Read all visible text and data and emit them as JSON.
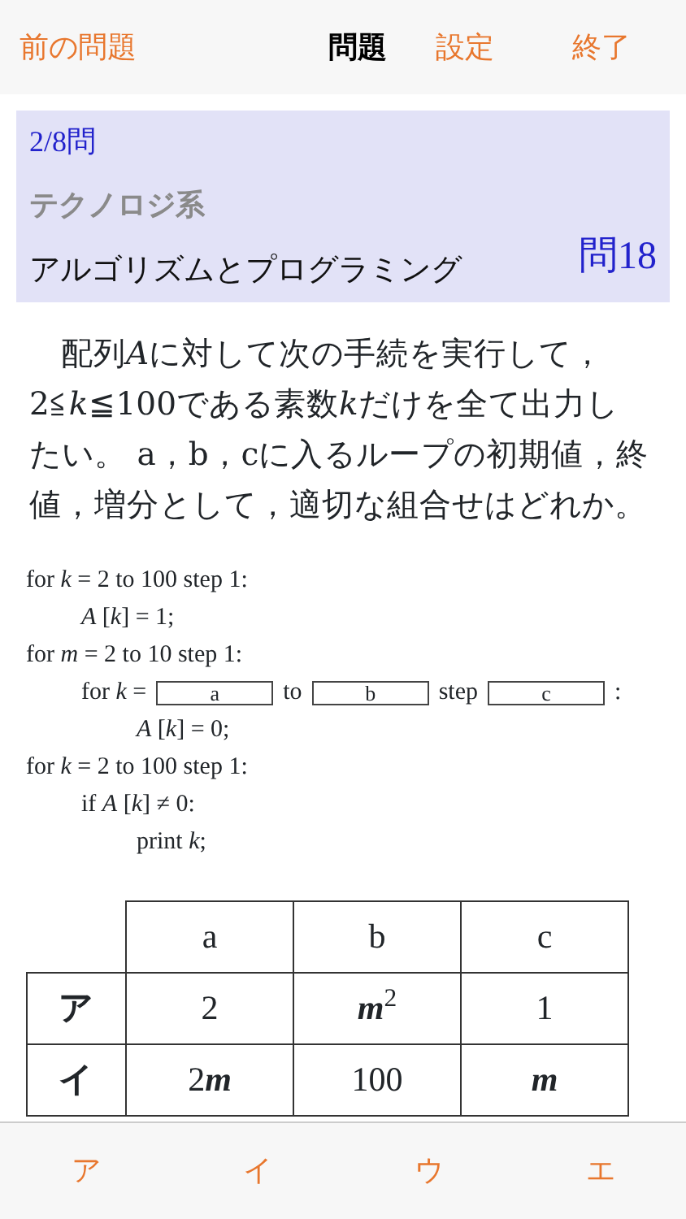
{
  "navbar": {
    "back": "前の問題",
    "title": "問題",
    "actions": [
      "設定",
      "終了"
    ]
  },
  "header": {
    "progress": "2/8問",
    "category": "テクノロジ系",
    "topic": "アルゴリズムとプログラミング",
    "number": "問18"
  },
  "question": [
    {
      "text": "配列",
      "italic": false
    },
    {
      "text": "A",
      "italic": true
    },
    {
      "text": "に対して次の手続を実行して，2≦",
      "italic": false
    },
    {
      "text": "k",
      "italic": true
    },
    {
      "text": "≦100である素数",
      "italic": false
    },
    {
      "text": "k",
      "italic": true
    },
    {
      "text": "だけを全て出力したい。 a，b，cに入るループの初期値，終値，増分として，適切な組合せはどれか。",
      "italic": false
    }
  ],
  "code": [
    {
      "kind": "text",
      "text": "for *k* = 2 to 100 step 1:",
      "children": [
        {
          "kind": "text",
          "text": "*A* [*k*] = 1;"
        }
      ]
    },
    {
      "kind": "text",
      "text": "for *m* = 2 to 10 step 1:",
      "children": [
        {
          "kind": "blanks",
          "prefix": "for *k* =",
          "blanks": [
            "a",
            "b",
            "c"
          ],
          "joiners": [
            "to",
            "step",
            ":"
          ],
          "children": [
            {
              "kind": "text",
              "text": "*A* [*k*] = 0;"
            }
          ]
        }
      ]
    },
    {
      "kind": "text",
      "text": "for *k* = 2 to 100 step 1:",
      "children": [
        {
          "kind": "text",
          "text": "if *A* [*k*] ≠ 0:",
          "children": [
            {
              "kind": "text",
              "text": "print *k*;"
            }
          ]
        }
      ]
    }
  ],
  "table": {
    "columns": [
      "a",
      "b",
      "c"
    ],
    "rows": [
      {
        "label": "ア",
        "cells": [
          [
            {
              "text": "2",
              "italic": false
            }
          ],
          [
            {
              "text": "m",
              "italic": true
            },
            {
              "text": "2",
              "italic": false,
              "sup": true
            }
          ],
          [
            {
              "text": "1",
              "italic": false
            }
          ]
        ]
      },
      {
        "label": "イ",
        "cells": [
          [
            {
              "text": "2",
              "italic": false
            },
            {
              "text": "m",
              "italic": true
            }
          ],
          [
            {
              "text": "100",
              "italic": false
            }
          ],
          [
            {
              "text": "m",
              "italic": true
            }
          ]
        ]
      }
    ]
  },
  "answers": [
    "ア",
    "イ",
    "ウ",
    "エ"
  ]
}
